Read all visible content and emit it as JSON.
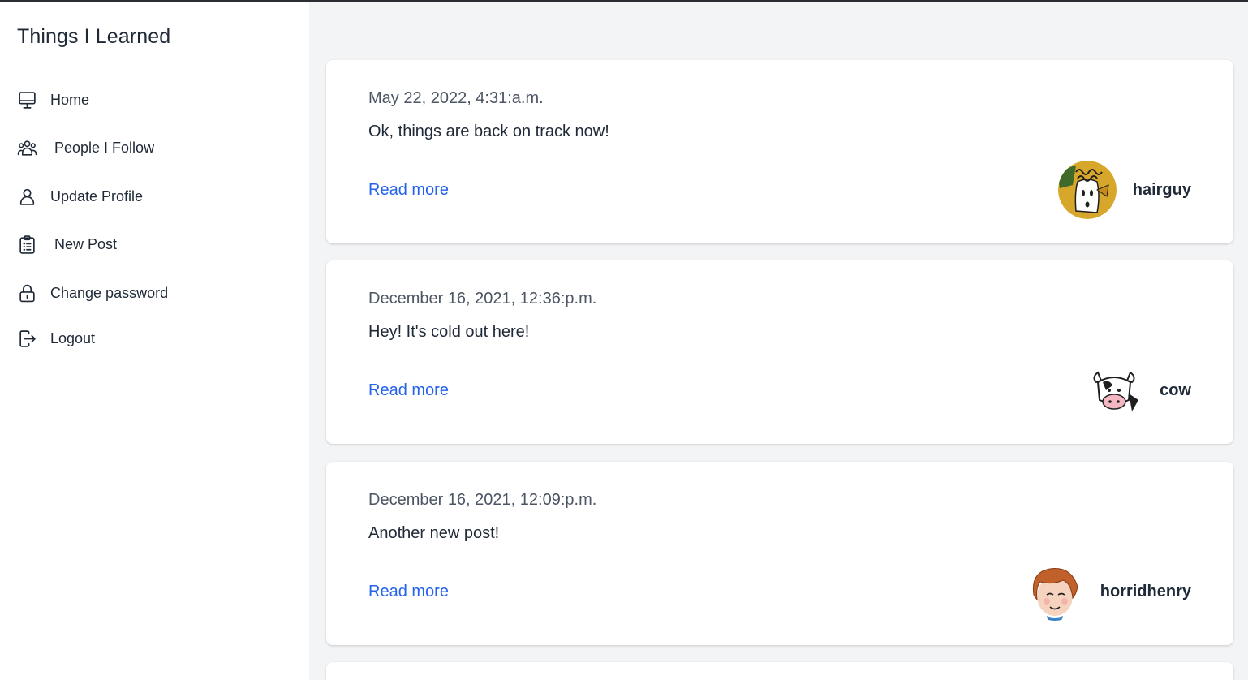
{
  "app": {
    "title": "Things I Learned"
  },
  "sidebar": {
    "items": [
      {
        "label": "Home",
        "icon": "monitor-icon"
      },
      {
        "label": "People I Follow",
        "icon": "users-icon"
      },
      {
        "label": "Update Profile",
        "icon": "user-icon"
      },
      {
        "label": "New Post",
        "icon": "clipboard-icon"
      },
      {
        "label": "Change password",
        "icon": "lock-icon"
      },
      {
        "label": "Logout",
        "icon": "logout-icon"
      }
    ]
  },
  "posts": [
    {
      "date": "May 22, 2022, 4:31:a.m.",
      "title": "Ok, things are back on track now!",
      "read_more": "Read more",
      "author": "hairguy",
      "avatar": "hairguy-avatar"
    },
    {
      "date": "December 16, 2021, 12:36:p.m.",
      "title": "Hey! It's cold out here!",
      "read_more": "Read more",
      "author": "cow",
      "avatar": "cow-avatar"
    },
    {
      "date": "December 16, 2021, 12:09:p.m.",
      "title": "Another new post!",
      "read_more": "Read more",
      "author": "horridhenry",
      "avatar": "horridhenry-avatar"
    }
  ],
  "colors": {
    "link": "#2563eb",
    "background": "#f3f4f6",
    "card": "#ffffff",
    "text": "#1f2937"
  }
}
